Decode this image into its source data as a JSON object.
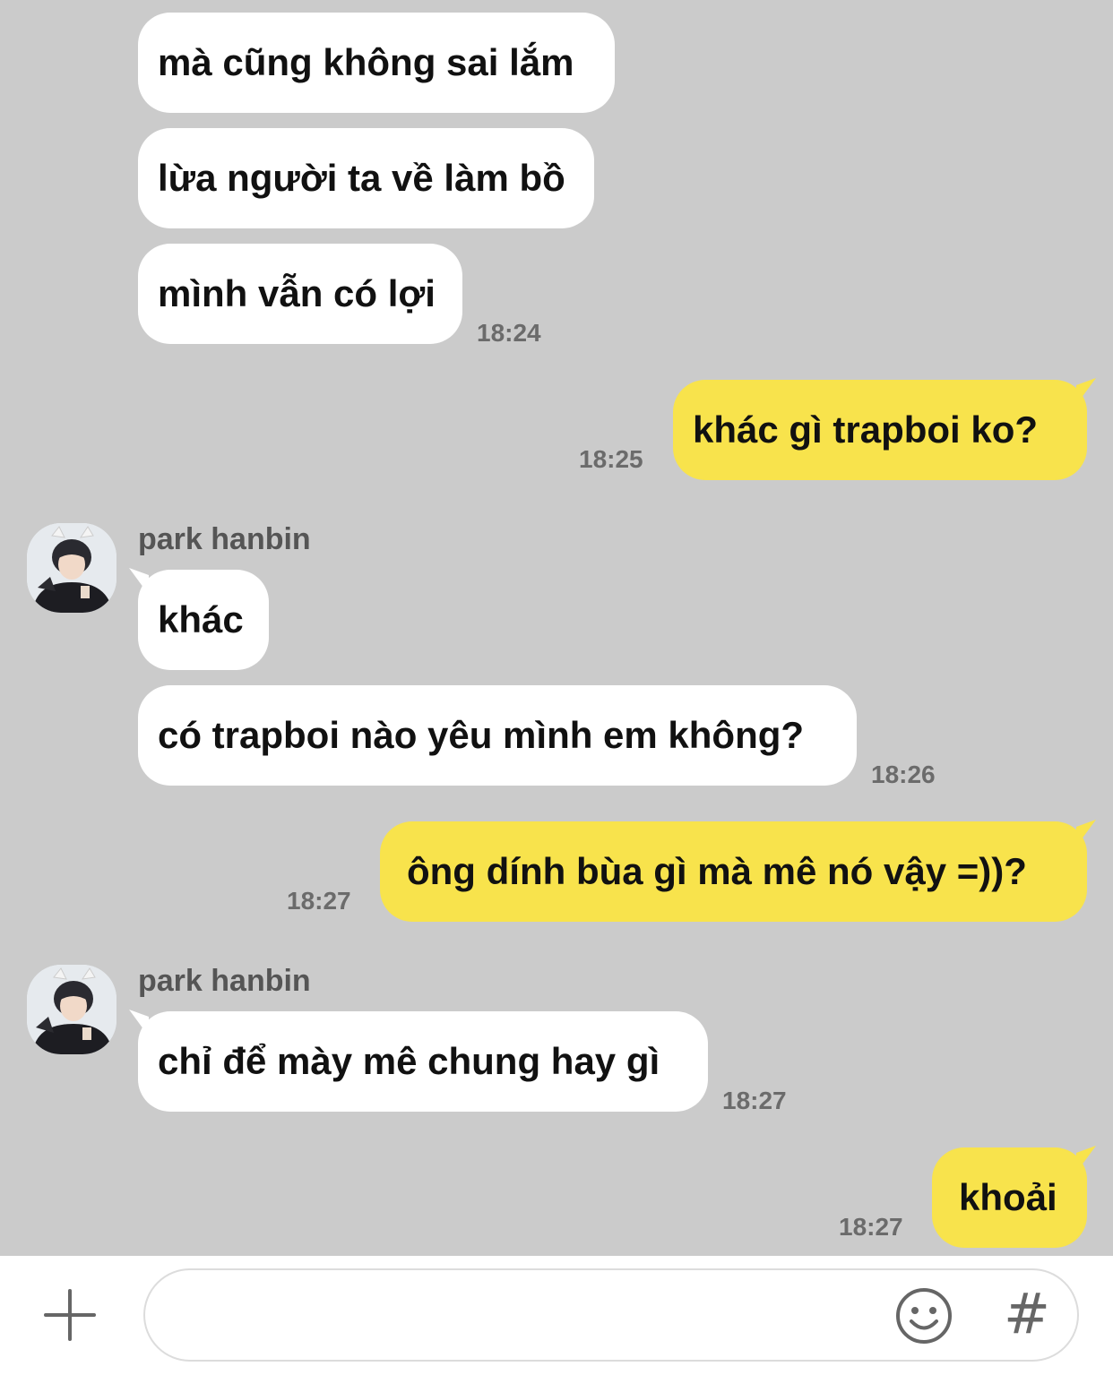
{
  "messages": [
    {
      "text": "mà cũng không sai lắm"
    },
    {
      "text": "lừa người ta về làm bồ"
    },
    {
      "text": "mình vẫn có lợi",
      "time": "18:24"
    },
    {
      "text": "khác gì trapboi ko?",
      "time": "18:25"
    },
    {
      "sender": "park hanbin",
      "text": "khác"
    },
    {
      "text": "có trapboi nào yêu mình em không?",
      "time": "18:26"
    },
    {
      "text": "ông dính bùa gì mà mê nó vậy =))?",
      "time": "18:27"
    },
    {
      "sender": "park hanbin",
      "text": "chỉ để mày mê chung hay gì",
      "time": "18:27"
    },
    {
      "text": "khoải",
      "time": "18:27"
    }
  ],
  "input": {
    "placeholder": ""
  },
  "icons": {
    "add": "plus-icon",
    "emoji": "emoji-icon",
    "hashtag": "hashtag-icon",
    "hash_glyph": "#"
  },
  "colors": {
    "background": "#cbcbcb",
    "incoming": "#ffffff",
    "outgoing": "#f8e34c"
  }
}
